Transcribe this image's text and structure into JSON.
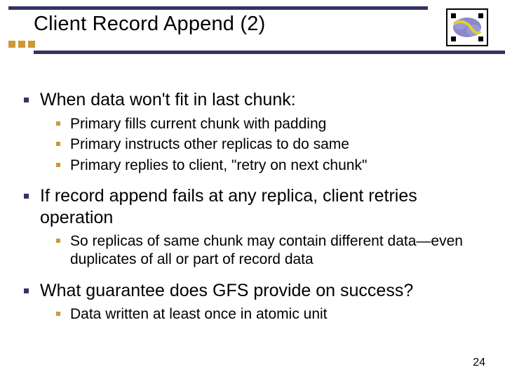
{
  "title": "Client Record Append (2)",
  "bullets": {
    "b1": "When data won't fit in last chunk:",
    "b1a": "Primary fills current chunk with padding",
    "b1b": "Primary instructs other replicas to do same",
    "b1c": "Primary replies to client, \"retry on next chunk\"",
    "b2": "If record append fails at any replica, client retries operation",
    "b2a": "So replicas of same chunk may contain different data—even duplicates of all or part of record data",
    "b3": "What guarantee does GFS provide on success?",
    "b3a": "Data written at least once in atomic unit"
  },
  "page_number": "24"
}
